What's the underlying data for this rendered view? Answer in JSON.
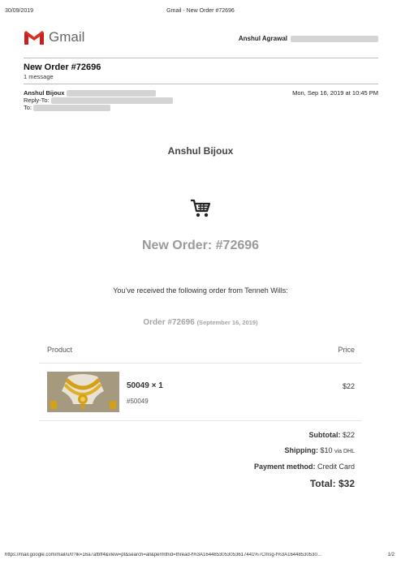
{
  "print_header": {
    "date": "30/09/2019",
    "title": "Gmail - New Order #72696"
  },
  "gmail": {
    "brand": "Gmail",
    "account_name": "Anshul Agrawal"
  },
  "thread": {
    "subject": "New Order #72696",
    "message_count": "1 message",
    "sender_name": "Anshul Bijoux",
    "sent_at": "Mon, Sep 16, 2019 at 10:45 PM",
    "reply_to_label": "Reply-To:",
    "to_label": "To:"
  },
  "email": {
    "shop_name": "Anshul Bijoux",
    "cart_icon": "shopping-cart-icon",
    "headline": "New Order: #72696",
    "intro": "You’ve received the following order from Tenneh Wills:",
    "order_label": "Order #72696",
    "order_date": "(September 16, 2019)",
    "table": {
      "col_product": "Product",
      "col_price": "Price",
      "items": [
        {
          "name": "50049 × 1",
          "sku": "#50049",
          "price": "$22"
        }
      ]
    },
    "totals": {
      "subtotal_label": "Subtotal:",
      "subtotal_value": "$22",
      "shipping_label": "Shipping:",
      "shipping_value": "$10",
      "shipping_via": "via DHL",
      "payment_label": "Payment method:",
      "payment_value": "Credit Card",
      "total_label": "Total:",
      "total_value": "$32"
    }
  },
  "print_footer": {
    "url": "https://mail.google.com/mail/u/0?ik=16a7afbff4&view=pt&search=all&permthid=thread-f%3A1644853053053617441%7Cmsg-f%3A16448530530…",
    "page": "1/2"
  },
  "colors": {
    "gmail_red": "#d93025",
    "headline_gray": "#9b9b9b",
    "gold": "#d4a017"
  }
}
